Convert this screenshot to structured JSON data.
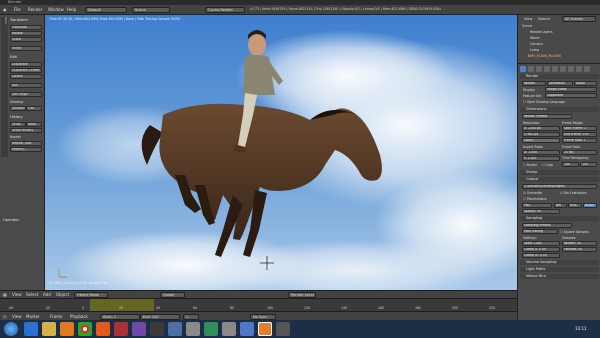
{
  "window": {
    "title": "Blender"
  },
  "top_menu": [
    "File",
    "Render",
    "Window",
    "Help"
  ],
  "screen_layout": "Default",
  "scene": "Scene",
  "render_engine": "Cycles Render",
  "top_stats": "v2.72 | Verts:5846749 | Faces:5821145 | Tris:11642290 | Objects:0/2 | Lamps:0/0 | Mem:622.68M | ORBS ELGIN PLUGIN",
  "tools_panel": {
    "transform_header": "Transform",
    "transform": [
      "Translate",
      "Rotate",
      "Scale",
      "Mirror"
    ],
    "edit_header": "Edit",
    "edit": [
      "Duplicate",
      "Duplicate Linked",
      "Delete"
    ],
    "join": "Join",
    "set_origin": "Set Origin",
    "shading_label": "Shading:",
    "shading": [
      "Smooth",
      "Flat"
    ],
    "history_header": "History",
    "history": [
      "Undo",
      "Redo",
      "Undo History",
      "Repeat Last",
      "History..."
    ],
    "repeat_header": "Repeat",
    "operator_header": "Operator",
    "tabs": [
      "Tools",
      "Create",
      "Relations",
      "Animation",
      "Physics",
      "Grease Pencil"
    ]
  },
  "viewport": {
    "info": "Time:01:30.49 | Mem:604.69M, Peak:604.69M | Done | Path Tracing Sample 50/50",
    "object_label": "(1) BMV_ELGIN_PLUGIN : Bridle.FS13"
  },
  "viewport_header": {
    "menus": [
      "View",
      "Select",
      "Add",
      "Object"
    ],
    "mode": "Object Mode",
    "pivot": "Global",
    "layer_label": "Render Layer"
  },
  "timeline": {
    "ticks": [
      "-40",
      "-20",
      "0",
      "20",
      "40",
      "60",
      "80",
      "100",
      "120",
      "140",
      "160",
      "180",
      "200",
      "220",
      "240",
      "260"
    ]
  },
  "timeline_header": {
    "menus": [
      "View",
      "Marker",
      "Frame",
      "Playback"
    ],
    "start": "Start:",
    "start_value": "1",
    "end": "End:",
    "end_value": "250",
    "current": "1",
    "sync": "No Sync"
  },
  "outliner": {
    "menus": [
      "View",
      "Search",
      "All Scenes"
    ],
    "items": [
      "Scene",
      "RenderLayers",
      "World",
      "Camera",
      "Lamp",
      "BMV_ELGIN_PLUGIN"
    ]
  },
  "properties": {
    "render_header": "Render",
    "render_buttons": [
      "Render",
      "Animation",
      "Audio"
    ],
    "display_label": "Display:",
    "display_value": "Image Editor",
    "feature_label": "Feature Set:",
    "feature_value": "Supported",
    "open_shading": "Open Shading Language",
    "dimensions_header": "Dimensions",
    "render_presets": "Render Presets",
    "resolution_label": "Resolution:",
    "frame_range_label": "Frame Range:",
    "res_x": "X:",
    "res_x_value": "2200 px",
    "res_y": "Y:",
    "res_y_value": "982 px",
    "res_pct": "100%",
    "start_frame": "Start Frame:",
    "start_frame_value": "1",
    "end_frame": "End Frame:",
    "end_frame_value": "250",
    "frame_step": "Frame Step:",
    "frame_step_value": "1",
    "aspect_label": "Aspect Ratio:",
    "frame_rate_label": "Frame Rate:",
    "asp_x": "X:",
    "asp_x_value": "1.000",
    "asp_y": "Y:",
    "asp_y_value": "1.000",
    "fps_value": "24 fps",
    "time_remap": "Time Remapping:",
    "border": "Border",
    "crop": "Crop",
    "old_value": "100",
    "new_value": "100",
    "stamp_header": "Stamp",
    "output_header": "Output",
    "output_path": "C:\\Render\\Scenes\\Images\\",
    "overwrite": "Overwrite",
    "file_ext": "File Extensions",
    "placeholders": "Placeholders",
    "format": "PNG",
    "bw": "BW",
    "rgb": "RGB",
    "rgba": "RGBA",
    "quality": "Quality:",
    "quality_value": "90",
    "sampling_header": "Sampling",
    "sampling_presets": "Sampling Presets",
    "path_tracing": "Path Tracing",
    "square_samples": "Square Samples",
    "settings_label": "Settings:",
    "samples_label": "Samples:",
    "seed": "Seed:",
    "seed_value": "1044",
    "render": "Render:",
    "render_value": "50",
    "clamp_direct": "Clamp D:",
    "clamp_direct_value": "0.00",
    "preview": "Preview:",
    "preview_value": "50",
    "clamp_indirect": "Clamp In:",
    "clamp_indirect_value": "0.00",
    "volume_sampling": "Volume Sampling",
    "light_paths": "Light Paths",
    "motion_blur": "Motion Blur"
  },
  "taskbar": {
    "time": "13:11",
    "date": "",
    "icons": [
      "start-orb",
      "ie-icon",
      "explorer-icon",
      "media-icon",
      "chrome-icon",
      "firefox-icon",
      "tool-icon",
      "tool2-icon",
      "blender-icon",
      "tool3-icon",
      "window-icon",
      "window2-icon",
      "globe-icon",
      "app-icon",
      "blender2-icon"
    ]
  },
  "colors": {
    "accent": "#5680c2",
    "timeline_range": "#8c8c24",
    "taskbar": "#1c2f47"
  }
}
